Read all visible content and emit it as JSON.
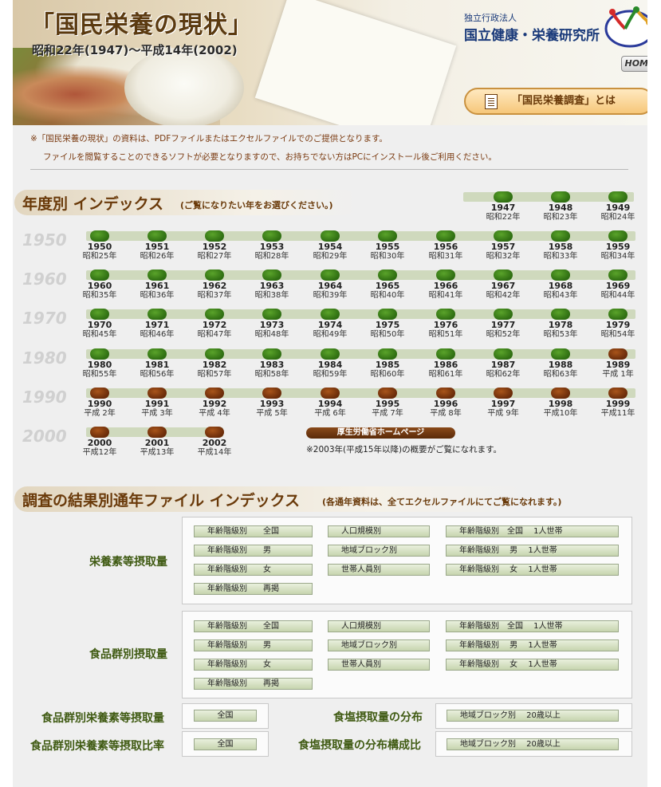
{
  "header": {
    "title": "「国民栄養の現状」",
    "subtitle": "昭和22年(1947)～平成14年(2002)",
    "org_small": "独立行政法人",
    "org_name": "国立健康・栄養研究所",
    "home_label": "HOME",
    "survey_label": "「国民栄養調査」とは"
  },
  "notes": {
    "line1": "※「国民栄養の現状」の資料は、PDFファイルまたはエクセルファイルでのご提供となります。",
    "line2": "ファイルを閲覧することのできるソフトが必要となりますので、お持ちでない方はPCにインストール後ご利用ください。"
  },
  "year_section": {
    "title": "年度別 インデックス",
    "hint": "(ご覧になりたい年をお選びください。)",
    "decades": [
      "1950",
      "1960",
      "1970",
      "1980",
      "1990",
      "2000"
    ],
    "rows": [
      [
        {
          "y": "1947",
          "e": "昭和22年",
          "c": "green"
        },
        {
          "y": "1948",
          "e": "昭和23年",
          "c": "green"
        },
        {
          "y": "1949",
          "e": "昭和24年",
          "c": "green"
        }
      ],
      [
        {
          "y": "1950",
          "e": "昭和25年",
          "c": "green"
        },
        {
          "y": "1951",
          "e": "昭和26年",
          "c": "green"
        },
        {
          "y": "1952",
          "e": "昭和27年",
          "c": "green"
        },
        {
          "y": "1953",
          "e": "昭和28年",
          "c": "green"
        },
        {
          "y": "1954",
          "e": "昭和29年",
          "c": "green"
        },
        {
          "y": "1955",
          "e": "昭和30年",
          "c": "green"
        },
        {
          "y": "1956",
          "e": "昭和31年",
          "c": "green"
        },
        {
          "y": "1957",
          "e": "昭和32年",
          "c": "green"
        },
        {
          "y": "1958",
          "e": "昭和33年",
          "c": "green"
        },
        {
          "y": "1959",
          "e": "昭和34年",
          "c": "green"
        }
      ],
      [
        {
          "y": "1960",
          "e": "昭和35年",
          "c": "green"
        },
        {
          "y": "1961",
          "e": "昭和36年",
          "c": "green"
        },
        {
          "y": "1962",
          "e": "昭和37年",
          "c": "green"
        },
        {
          "y": "1963",
          "e": "昭和38年",
          "c": "green"
        },
        {
          "y": "1964",
          "e": "昭和39年",
          "c": "green"
        },
        {
          "y": "1965",
          "e": "昭和40年",
          "c": "green"
        },
        {
          "y": "1966",
          "e": "昭和41年",
          "c": "green"
        },
        {
          "y": "1967",
          "e": "昭和42年",
          "c": "green"
        },
        {
          "y": "1968",
          "e": "昭和43年",
          "c": "green"
        },
        {
          "y": "1969",
          "e": "昭和44年",
          "c": "green"
        }
      ],
      [
        {
          "y": "1970",
          "e": "昭和45年",
          "c": "green"
        },
        {
          "y": "1971",
          "e": "昭和46年",
          "c": "green"
        },
        {
          "y": "1972",
          "e": "昭和47年",
          "c": "green"
        },
        {
          "y": "1973",
          "e": "昭和48年",
          "c": "green"
        },
        {
          "y": "1974",
          "e": "昭和49年",
          "c": "green"
        },
        {
          "y": "1975",
          "e": "昭和50年",
          "c": "green"
        },
        {
          "y": "1976",
          "e": "昭和51年",
          "c": "green"
        },
        {
          "y": "1977",
          "e": "昭和52年",
          "c": "green"
        },
        {
          "y": "1978",
          "e": "昭和53年",
          "c": "green"
        },
        {
          "y": "1979",
          "e": "昭和54年",
          "c": "green"
        }
      ],
      [
        {
          "y": "1980",
          "e": "昭和55年",
          "c": "green"
        },
        {
          "y": "1981",
          "e": "昭和56年",
          "c": "green"
        },
        {
          "y": "1982",
          "e": "昭和57年",
          "c": "green"
        },
        {
          "y": "1983",
          "e": "昭和58年",
          "c": "green"
        },
        {
          "y": "1984",
          "e": "昭和59年",
          "c": "green"
        },
        {
          "y": "1985",
          "e": "昭和60年",
          "c": "green"
        },
        {
          "y": "1986",
          "e": "昭和61年",
          "c": "green"
        },
        {
          "y": "1987",
          "e": "昭和62年",
          "c": "green"
        },
        {
          "y": "1988",
          "e": "昭和63年",
          "c": "green"
        },
        {
          "y": "1989",
          "e": "平成 1年",
          "c": "brown"
        }
      ],
      [
        {
          "y": "1990",
          "e": "平成 2年",
          "c": "brown"
        },
        {
          "y": "1991",
          "e": "平成 3年",
          "c": "brown"
        },
        {
          "y": "1992",
          "e": "平成 4年",
          "c": "brown"
        },
        {
          "y": "1993",
          "e": "平成 5年",
          "c": "brown"
        },
        {
          "y": "1994",
          "e": "平成 6年",
          "c": "brown"
        },
        {
          "y": "1995",
          "e": "平成 7年",
          "c": "brown"
        },
        {
          "y": "1996",
          "e": "平成 8年",
          "c": "brown"
        },
        {
          "y": "1997",
          "e": "平成 9年",
          "c": "brown"
        },
        {
          "y": "1998",
          "e": "平成10年",
          "c": "brown"
        },
        {
          "y": "1999",
          "e": "平成11年",
          "c": "brown"
        }
      ],
      [
        {
          "y": "2000",
          "e": "平成12年",
          "c": "brown"
        },
        {
          "y": "2001",
          "e": "平成13年",
          "c": "brown"
        },
        {
          "y": "2002",
          "e": "平成14年",
          "c": "brown"
        }
      ]
    ],
    "mhlw_label": "厚生労働省ホームページ",
    "mhlw_note": "※2003年(平成15年以降)の概要がご覧になれます。"
  },
  "results_section": {
    "title": "調査の結果別通年ファイル インデックス",
    "hint": "(各通年資料は、全てエクセルファイルにてご覧になれます。)",
    "nutrient": {
      "label": "栄養素等摂取量",
      "col1": [
        "年齢階級別　　全国",
        "年齢階級別　　男",
        "年齢階級別　　女",
        "年齢階級別　　再掲"
      ],
      "col2": [
        "人口規模別",
        "地域ブロック別",
        "世帯人員別"
      ],
      "col3": [
        "年齢階級別　全国　 1人世帯",
        "年齢階級別　 男　 1人世帯",
        "年齢階級別　 女　 1人世帯"
      ]
    },
    "food": {
      "label": "食品群別摂取量",
      "col1": [
        "年齢階級別　　全国",
        "年齢階級別　　男",
        "年齢階級別　　女",
        "年齢階級別　　再掲"
      ],
      "col2": [
        "人口規模別",
        "地域ブロック別",
        "世帯人員別"
      ],
      "col3": [
        "年齢階級別　全国　 1人世帯",
        "年齢階級別　 男　 1人世帯",
        "年齢階級別　 女　 1人世帯"
      ]
    },
    "food_nutrient": {
      "label": "食品群別栄養素等摂取量",
      "button": "全国"
    },
    "food_nutrient_ratio": {
      "label": "食品群別栄養素等摂取比率",
      "button": "全国"
    },
    "salt_dist": {
      "label": "食塩摂取量の分布",
      "button": "地域ブロック別　 20歳以上"
    },
    "salt_ratio": {
      "label": "食塩摂取量の分布構成比",
      "button": "地域ブロック別　 20歳以上"
    }
  }
}
